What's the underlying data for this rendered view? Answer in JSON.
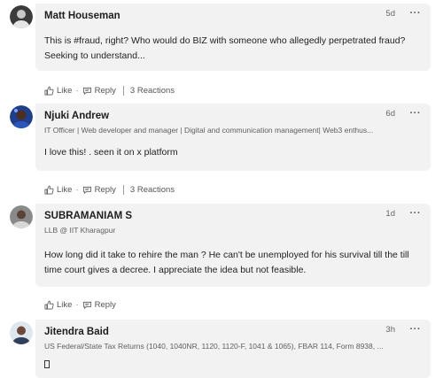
{
  "comments": [
    {
      "author": "Matt Houseman",
      "headline": "",
      "time": "5d",
      "more": "···",
      "text": "This is #fraud, right? Who would do BIZ with someone who allegedly perpetrated fraud? Seeking to understand...",
      "like_label": "Like",
      "reply_label": "Reply",
      "reactions": "3 Reactions"
    },
    {
      "author": "Njuki Andrew",
      "headline": "IT Officer | Web developer and manager | Digital and communication management| Web3 enthus...",
      "time": "6d",
      "more": "···",
      "text": "I love this! . seen it on x platform",
      "like_label": "Like",
      "reply_label": "Reply",
      "reactions": "3 Reactions"
    },
    {
      "author": "SUBRAMANIAM S",
      "headline": "LLB @ IIT Kharagpur",
      "time": "1d",
      "more": "···",
      "text": "How long did it take to rehire the man ? He can't be unemployed for his survival till the till time court gives a decree. I appreciate the idea but not feasible.",
      "like_label": "Like",
      "reply_label": "Reply",
      "reactions": ""
    },
    {
      "author": "Jitendra Baid",
      "headline": "US Federal/State Tax Returns (1040, 1040NR, 1120, 1120-F, 1041 & 1065), FBAR 114, Form 8938, ...",
      "time": "3h",
      "more": "···",
      "text": "",
      "like_label": "",
      "reply_label": "",
      "reactions": ""
    }
  ],
  "icons": {
    "like": "thumbs-up-icon",
    "reply": "speech-bubble-icon",
    "more": "ellipsis-icon",
    "unknown_glyph": "missing-glyph-box"
  },
  "colors": {
    "bubble": "#f2f2f2",
    "text": "#191919",
    "muted": "#5f5f5f"
  }
}
